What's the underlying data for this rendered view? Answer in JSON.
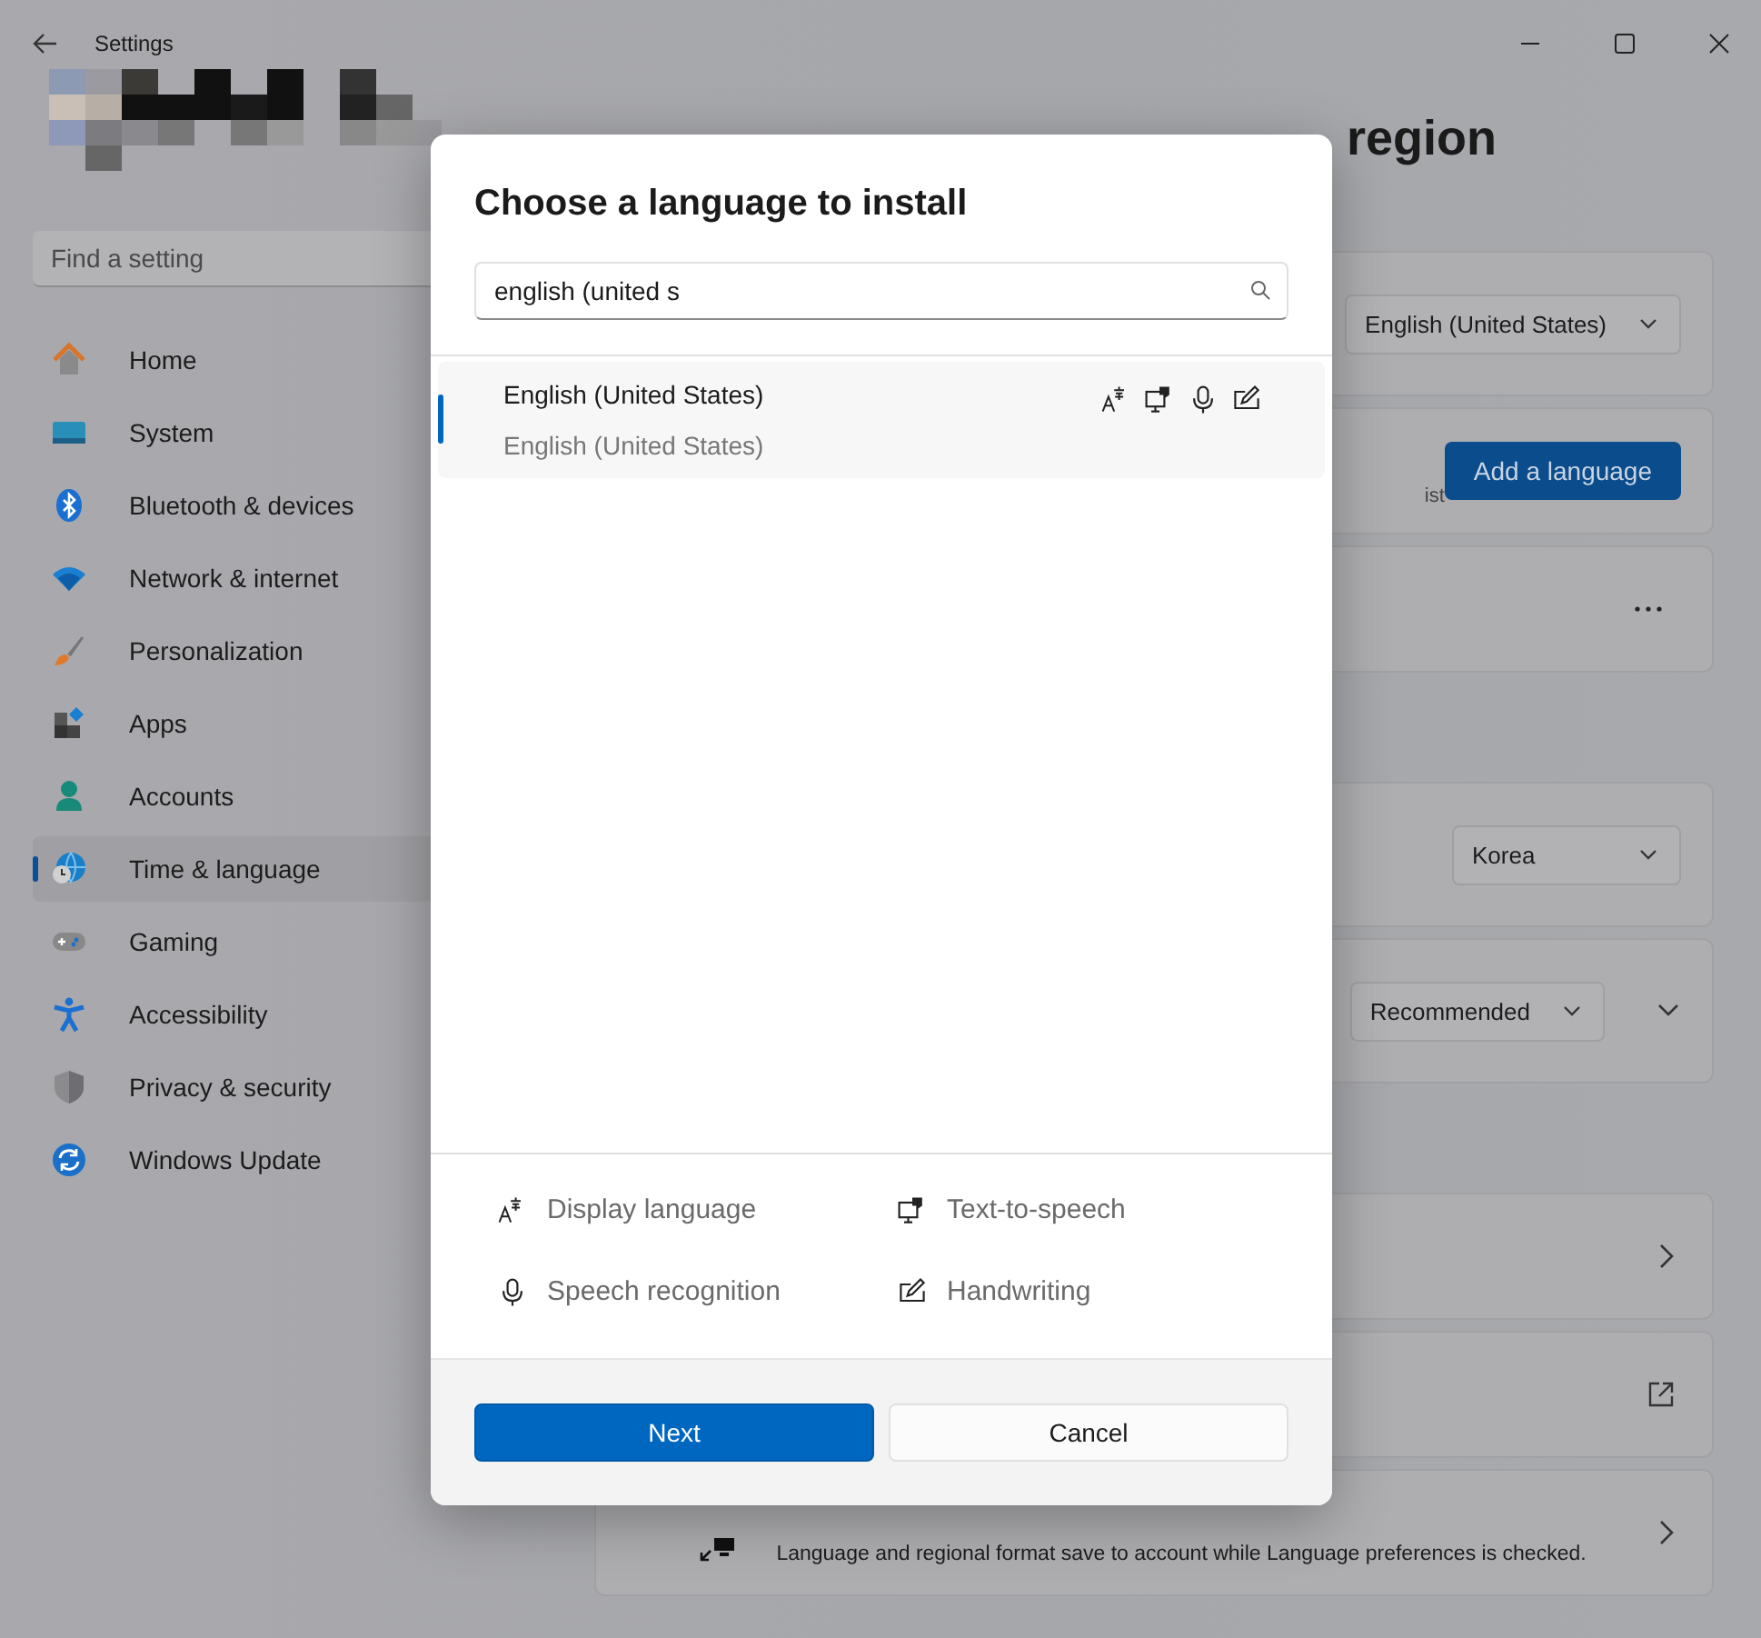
{
  "window": {
    "title": "Settings"
  },
  "sidebar": {
    "search": {
      "placeholder": "Find a setting"
    },
    "items": [
      {
        "label": "Home",
        "selected": false
      },
      {
        "label": "System",
        "selected": false
      },
      {
        "label": "Bluetooth & devices",
        "selected": false
      },
      {
        "label": "Network & internet",
        "selected": false
      },
      {
        "label": "Personalization",
        "selected": false
      },
      {
        "label": "Apps",
        "selected": false
      },
      {
        "label": "Accounts",
        "selected": false
      },
      {
        "label": "Time & language",
        "selected": true
      },
      {
        "label": "Gaming",
        "selected": false
      },
      {
        "label": "Accessibility",
        "selected": false
      },
      {
        "label": "Privacy & security",
        "selected": false
      },
      {
        "label": "Windows Update",
        "selected": false
      }
    ]
  },
  "page": {
    "title": "region",
    "sections": [
      {
        "cards": [
          {
            "kind": "dropdown",
            "value": "English (United States)"
          },
          {
            "kind": "button",
            "fragment": "ist",
            "button": "Add a language"
          },
          {
            "kind": "more"
          }
        ]
      },
      {
        "cards": [
          {
            "kind": "dropdown",
            "value": "Korea"
          },
          {
            "kind": "dropdown_expand",
            "value": "Recommended"
          }
        ]
      },
      {
        "cards": [
          {
            "kind": "link"
          },
          {
            "kind": "external"
          },
          {
            "kind": "link",
            "description": "Language and regional format save to account while Language preferences is checked."
          }
        ]
      }
    ]
  },
  "dialog": {
    "title": "Choose a language to install",
    "search": {
      "value": "english (united s"
    },
    "results": [
      {
        "name": "English (United States)",
        "subtitle": "English (United States)",
        "selected": true
      }
    ],
    "features": [
      {
        "label": "Display language"
      },
      {
        "label": "Text-to-speech"
      },
      {
        "label": "Speech recognition"
      },
      {
        "label": "Handwriting"
      }
    ],
    "buttons": [
      {
        "label": "Next",
        "kind": "primary"
      },
      {
        "label": "Cancel",
        "kind": "secondary"
      }
    ]
  }
}
